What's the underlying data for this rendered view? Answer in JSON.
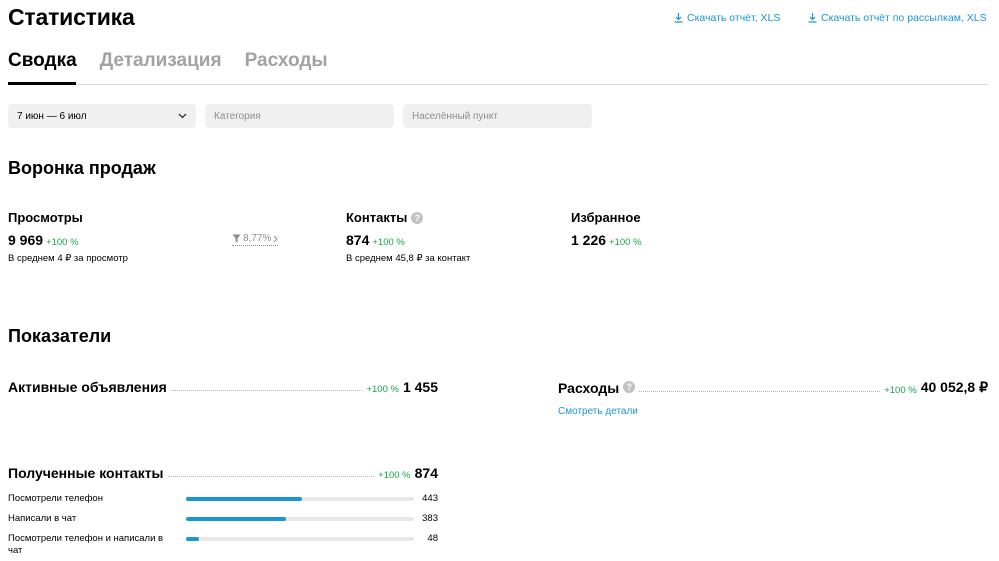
{
  "header": {
    "title": "Статистика",
    "download_report": "Скачать отчёт, XLS",
    "download_mailing_report": "Скачать отчёт по рассылкам, XLS"
  },
  "tabs": [
    {
      "label": "Сводка",
      "active": true
    },
    {
      "label": "Детализация",
      "active": false
    },
    {
      "label": "Расходы",
      "active": false
    }
  ],
  "filters": {
    "date_range": "7 июн — 6 июл",
    "category_placeholder": "Категория",
    "city_placeholder": "Населённый пункт"
  },
  "funnel": {
    "title": "Воронка продаж",
    "views": {
      "label": "Просмотры",
      "value": "9 969",
      "delta": "+100 %",
      "note": "В среднем 4 ₽ за просмотр"
    },
    "conversion": "8,77%",
    "contacts": {
      "label": "Контакты",
      "value": "874",
      "delta": "+100 %",
      "note": "В среднем 45,8 ₽ за контакт",
      "help": "?"
    },
    "favorites": {
      "label": "Избранное",
      "value": "1 226",
      "delta": "+100 %"
    }
  },
  "metrics": {
    "title": "Показатели",
    "active_ads": {
      "label": "Активные объявления",
      "delta": "+100 %",
      "value": "1 455"
    },
    "expenses": {
      "label": "Расходы",
      "delta": "+100 %",
      "value": "40 052,8 ₽",
      "link": "Смотреть детали",
      "help": "?"
    },
    "received_contacts": {
      "label": "Полученные контакты",
      "delta": "+100 %",
      "value": "874",
      "breakdown": [
        {
          "label": "Посмотрели телефон",
          "value": "443",
          "fraction": 0.51
        },
        {
          "label": "Написали в чат",
          "value": "383",
          "fraction": 0.44
        },
        {
          "label": "Посмотрели телефон и написали в чат",
          "value": "48",
          "fraction": 0.055
        }
      ]
    }
  },
  "colors": {
    "accent": "#1a96d4",
    "positive": "#17a34a",
    "muted": "#a2a2a2"
  }
}
